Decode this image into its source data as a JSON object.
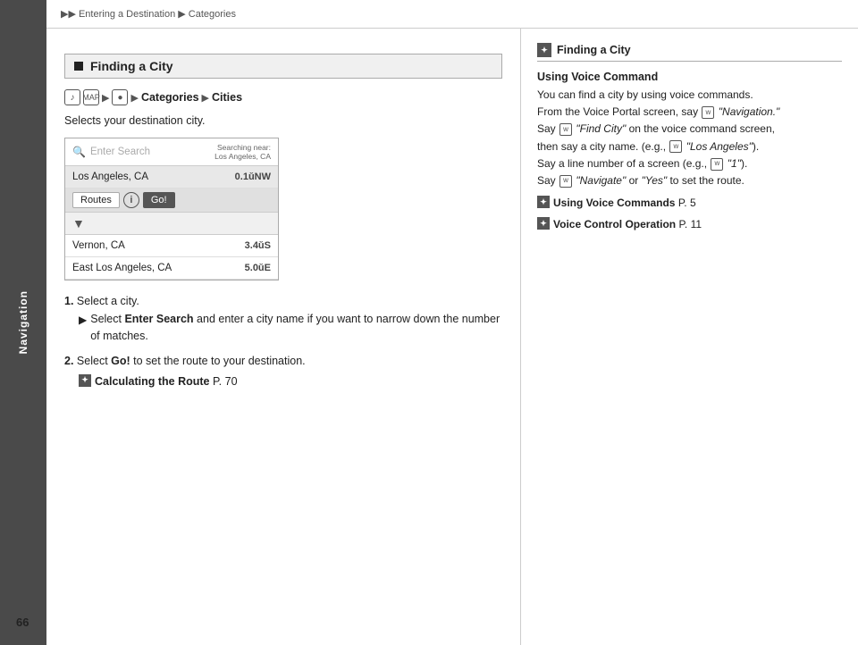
{
  "sidebar": {
    "label": "Navigation"
  },
  "page_number": "66",
  "breadcrumb": {
    "items": [
      "Entering a Destination",
      "Categories"
    ],
    "arrows": [
      "▶▶",
      "▶"
    ]
  },
  "section": {
    "heading": "Finding a City",
    "path": {
      "parts": [
        {
          "type": "icon",
          "text": "♪"
        },
        {
          "type": "icon",
          "text": "MAP"
        },
        {
          "type": "arrow",
          "text": "▶"
        },
        {
          "type": "icon",
          "text": "●"
        },
        {
          "type": "arrow",
          "text": "▶"
        },
        {
          "type": "bold",
          "text": "Categories"
        },
        {
          "type": "arrow",
          "text": "▶"
        },
        {
          "type": "bold",
          "text": "Cities"
        }
      ]
    },
    "selects_desc": "Selects your destination city.",
    "ui_mockup": {
      "search_placeholder": "Enter Search",
      "searching_near": "Searching near:\nLos Angeles, CA",
      "cities": [
        {
          "name": "Los Angeles, CA",
          "distance": "0.1⁴ NW",
          "selected": true
        },
        {
          "name": "Vernon, CA",
          "distance": "3.4⁴ S"
        },
        {
          "name": "East Los Angeles, CA",
          "distance": "5.0⁴ E"
        }
      ],
      "actions": [
        "Routes",
        "ℹ",
        "Go!"
      ]
    },
    "steps": [
      {
        "num": "1.",
        "text": "Select a city.",
        "sub": "Select Enter Search and enter a city name if you want to narrow down the number of matches."
      },
      {
        "num": "2.",
        "text": "Select Go! to set the route to your destination.",
        "cross_ref": "Calculating the Route P. 70"
      }
    ]
  },
  "right_panel": {
    "section_title": "Finding a City",
    "voice_command_title": "Using Voice Command",
    "voice_lines": [
      "You can find a city by using voice commands.",
      "From the Voice Portal screen, say",
      "“Navigation.”",
      "Say",
      "“Find City” on the voice command screen,",
      "then say a city name. (e.g.,",
      "“Los Angeles”).",
      "Say a line number of a screen (e.g.,",
      "“1”).",
      "Say",
      "“Navigate” or “Yes” to set the route."
    ],
    "cross_refs": [
      {
        "text": "Using Voice Commands",
        "page": "P. 5"
      },
      {
        "text": "Voice Control Operation",
        "page": "P. 11"
      }
    ]
  }
}
